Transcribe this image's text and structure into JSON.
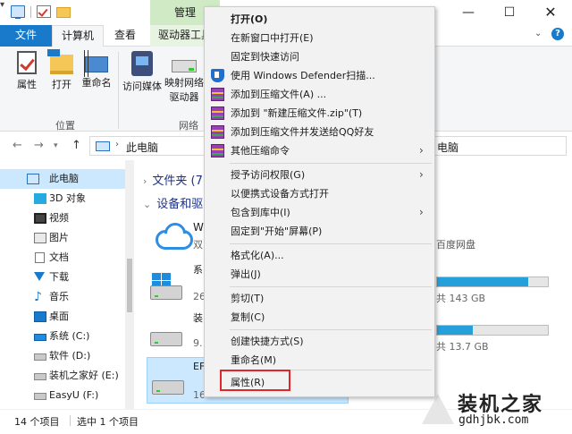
{
  "ribbon": {
    "context_tab": "管理",
    "tabs": {
      "file": "文件",
      "computer": "计算机",
      "view": "查看",
      "drive_tools": "驱动器工具"
    },
    "buttons": {
      "properties": "属性",
      "open": "打开",
      "rename": "重命名",
      "access_media": "访问媒体",
      "map_drive_line1": "映射网络",
      "map_drive_line2": "驱动器"
    },
    "groups": {
      "location": "位置",
      "network": "网络"
    }
  },
  "window_controls": {
    "minimize": "—",
    "maximize": "☐",
    "close": "✕"
  },
  "address": {
    "location": "此电脑",
    "search_fragment": "电脑"
  },
  "nav_pane": {
    "items": [
      {
        "label": "此电脑",
        "icon": "pc-icon"
      },
      {
        "label": "3D 对象",
        "icon": "cube-icon"
      },
      {
        "label": "视频",
        "icon": "video-icon"
      },
      {
        "label": "图片",
        "icon": "picture-icon"
      },
      {
        "label": "文档",
        "icon": "document-icon"
      },
      {
        "label": "下载",
        "icon": "download-icon"
      },
      {
        "label": "音乐",
        "icon": "music-icon"
      },
      {
        "label": "桌面",
        "icon": "desktop-icon"
      },
      {
        "label": "系统 (C:)",
        "icon": "windows-drive-icon"
      },
      {
        "label": "软件 (D:)",
        "icon": "drive-icon"
      },
      {
        "label": "装机之家好 (E:)",
        "icon": "drive-icon"
      },
      {
        "label": "EasyU (F:)",
        "icon": "drive-icon"
      }
    ]
  },
  "content": {
    "folders_header": "文件夹 (7",
    "devices_header": "设备和驱",
    "cloud_label_partial": "W",
    "cloud_sub_partial": "双",
    "cloud_right": "百度网盘",
    "drive1_label_partial": "系",
    "drive1_free_partial": "26",
    "drive1_total": "共 143 GB",
    "drive1_fill": 0.82,
    "drive2_label_partial": "装",
    "drive2_free_partial": "9.",
    "drive2_total": "共 13.7 GB",
    "drive2_fill": 0.32,
    "drive3_label_partial": "EF",
    "drive3_free_partial": "16"
  },
  "status": {
    "item_count": "14 个项目",
    "selected": "选中 1 个项目"
  },
  "watermark": {
    "title": "装机之家",
    "url": "gdhjbk.com"
  },
  "context_menu": {
    "items": [
      {
        "label": "打开(O)",
        "bold": true
      },
      {
        "label": "在新窗口中打开(E)"
      },
      {
        "label": "固定到快速访问"
      },
      {
        "label": "使用 Windows Defender扫描...",
        "icon": "shield-icon"
      },
      {
        "label": "添加到压缩文件(A) ...",
        "icon": "archive-icon"
      },
      {
        "label": "添加到 \"新建压缩文件.zip\"(T)",
        "icon": "archive-icon"
      },
      {
        "label": "添加到压缩文件并发送给QQ好友",
        "icon": "archive-icon"
      },
      {
        "label": "其他压缩命令",
        "icon": "archive-icon",
        "submenu": true
      },
      {
        "label": "授予访问权限(G)",
        "submenu": true
      },
      {
        "label": "以便携式设备方式打开"
      },
      {
        "label": "包含到库中(I)",
        "submenu": true
      },
      {
        "label": "固定到\"开始\"屏幕(P)"
      },
      {
        "label": "格式化(A)..."
      },
      {
        "label": "弹出(J)"
      },
      {
        "label": "剪切(T)"
      },
      {
        "label": "复制(C)"
      },
      {
        "label": "创建快捷方式(S)"
      },
      {
        "label": "重命名(M)"
      },
      {
        "label": "属性(R)"
      }
    ],
    "highlight_color": "#e0262a"
  }
}
